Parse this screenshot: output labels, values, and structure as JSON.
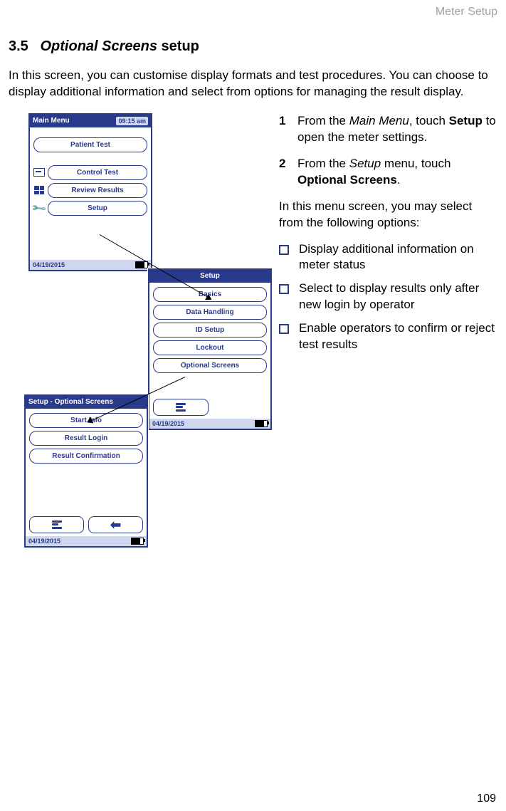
{
  "chapter": "Meter Setup",
  "heading_number": "3.5",
  "heading_title_italic": "Optional Screens",
  "heading_title_rest": " setup",
  "intro": "In this screen, you can customise display formats and test procedures. You can choose to display additional information and select from options for managing the result display.",
  "steps": [
    {
      "num": "1",
      "pre": "From the ",
      "italic": "Main Menu",
      "mid": ", touch ",
      "bold": "Setup",
      "post": " to open the meter settings."
    },
    {
      "num": "2",
      "pre": "From the ",
      "italic": "Setup",
      "mid": " menu, touch ",
      "bold": "Optional Screens",
      "post": "."
    }
  ],
  "menu_intro": "In this menu screen, you may select from the following options:",
  "bullets": [
    "Display additional information on meter status",
    "Select to display results only after new login by operator",
    "Enable operators to confirm or reject test results"
  ],
  "page_number": "109",
  "screens": {
    "main": {
      "title": "Main Menu",
      "time": "09:15 am",
      "patient_test": "Patient Test",
      "control_test": "Control Test",
      "review_results": "Review Results",
      "setup": "Setup",
      "date": "04/19/2015"
    },
    "setup": {
      "title": "Setup",
      "basics": "Basics",
      "data_handling": "Data Handling",
      "id_setup": "ID Setup",
      "lockout": "Lockout",
      "optional_screens": "Optional Screens",
      "date": "04/19/2015"
    },
    "optional": {
      "title": "Setup - Optional Screens",
      "start_info": "Start Info",
      "result_login": "Result Login",
      "result_confirmation": "Result Confirmation",
      "date": "04/19/2015"
    }
  }
}
